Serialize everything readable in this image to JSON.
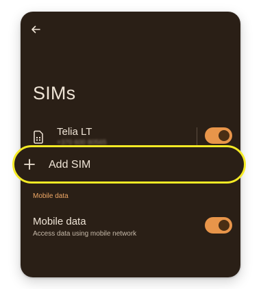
{
  "header": {
    "back_icon": "arrow-left-icon",
    "title": "SIMs"
  },
  "sims": [
    {
      "icon": "sim-card-icon",
      "name": "Telia LT",
      "number": "+370 600 80565",
      "enabled": true
    }
  ],
  "add_sim": {
    "icon": "plus-icon",
    "label": "Add SIM"
  },
  "mobile_data_section": {
    "header": "Mobile data",
    "title": "Mobile data",
    "subtitle": "Access data using mobile network",
    "enabled": true
  },
  "colors": {
    "background": "#2a1f16",
    "text": "#efe4d6",
    "accent": "#e8954a",
    "section_header": "#f0a866",
    "highlight": "#f4ea25"
  }
}
